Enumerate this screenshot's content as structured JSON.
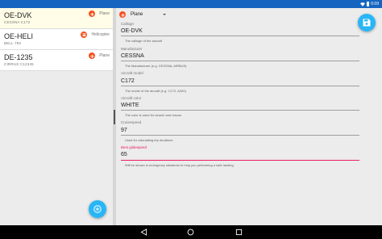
{
  "status_bar": {
    "time": "6:09"
  },
  "aircraft_list": [
    {
      "callsign": "OE-DVK",
      "model": "CESSNA C172",
      "type": "Plane",
      "selected": true
    },
    {
      "callsign": "OE-HELI",
      "model": "BELL 750",
      "type": "Helicopter",
      "selected": false
    },
    {
      "callsign": "DE-1235",
      "model": "CIRRUS C12345",
      "type": "Plane",
      "selected": false
    }
  ],
  "detail": {
    "type_selector": {
      "value": "Plane"
    },
    "fields": {
      "callsign": {
        "label": "Callsign",
        "value": "OE-DVK",
        "helper": "The callsign of the aircraft"
      },
      "manufacturer": {
        "label": "Manufacturer",
        "value": "CESSNA",
        "helper": "The Manufacturer (e.g. CESSNA, AIRBUS)"
      },
      "model": {
        "label": "Aircraft model",
        "value": "C172",
        "helper": "The model of the aircraft (e.g. C172, A320)"
      },
      "color": {
        "label": "Aircraft color",
        "value": "WHITE",
        "helper": "The color is used for search and rescue"
      },
      "cruise_speed": {
        "label": "Cruisespeed",
        "value": "97",
        "helper": "Used for calculating trip durations"
      },
      "glide_speed": {
        "label": "Best glidespeed",
        "value": "65",
        "helper": "Will be shown in emergency situations to help you performing a safe landing"
      }
    }
  },
  "icons": {
    "plane_type": "airplane-icon",
    "helicopter_type": "helicopter-icon",
    "add": "plus-circle-icon",
    "save": "floppy-disk-icon",
    "nav_back": "back-triangle-icon",
    "nav_home": "home-circle-icon",
    "nav_recents": "recents-square-icon"
  },
  "colors": {
    "status_bar": "#1565c0",
    "accent": "#29b6f6",
    "type_icon": "#f4511e",
    "focus": "#e91e63",
    "selected_row": "#fffde7"
  }
}
